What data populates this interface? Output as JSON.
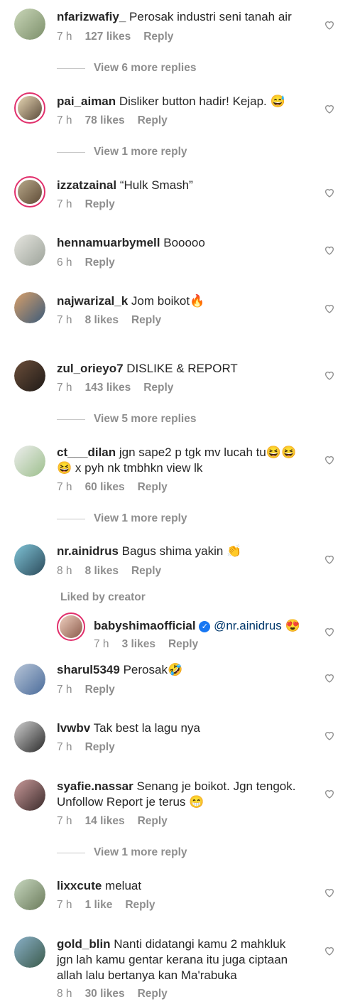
{
  "comments": [
    {
      "user": "nfarizwafiy_",
      "text": "Perosak industri seni tanah air",
      "time": "7 h",
      "likes": "127 likes",
      "reply": "Reply"
    },
    {
      "user": "pai_aiman",
      "text": "Disliker button hadir! Kejap. 😅",
      "time": "7 h",
      "likes": "78 likes",
      "reply": "Reply"
    },
    {
      "user": "izzatzainal",
      "text": "“Hulk Smash”",
      "time": "7 h",
      "likes": "",
      "reply": "Reply"
    },
    {
      "user": "hennamuarbymell",
      "text": "Booooo",
      "time": "6 h",
      "likes": "",
      "reply": "Reply"
    },
    {
      "user": "najwarizal_k",
      "text": "Jom boikot🔥",
      "time": "7 h",
      "likes": "8 likes",
      "reply": "Reply"
    },
    {
      "user": "zul_orieyo7",
      "text": "DISLIKE & REPORT",
      "time": "7 h",
      "likes": "143 likes",
      "reply": "Reply"
    },
    {
      "user": "ct___dilan",
      "text": "jgn sape2 p tgk mv lucah tu😆😆",
      "text2": "😆 x pyh nk tmbhkn view lk",
      "time": "7 h",
      "likes": "60 likes",
      "reply": "Reply"
    },
    {
      "user": "nr.ainidrus",
      "text": "Bagus shima yakin 👏",
      "time": "8 h",
      "likes": "8 likes",
      "reply": "Reply"
    },
    {
      "user": "babyshimaofficial",
      "mention": "@nr.ainidrus",
      "text": "😍",
      "time": "7 h",
      "likes": "3 likes",
      "reply": "Reply"
    },
    {
      "user": "sharul5349",
      "text": "Perosak🤣",
      "time": "7 h",
      "likes": "",
      "reply": "Reply"
    },
    {
      "user": "lvwbv",
      "text": "Tak best la lagu nya",
      "time": "7 h",
      "likes": "",
      "reply": "Reply"
    },
    {
      "user": "syafie.nassar",
      "text": "Senang je boikot. Jgn tengok.",
      "text2": "Unfollow Report je terus 😁",
      "time": "7 h",
      "likes": "14 likes",
      "reply": "Reply"
    },
    {
      "user": "lixxcute",
      "text": "meluat",
      "time": "7 h",
      "likes": "1 like",
      "reply": "Reply"
    },
    {
      "user": "gold_blin",
      "text": "Nanti didatangi kamu 2 mahkluk",
      "text2": "jgn lah kamu gentar kerana itu juga ciptaan",
      "text3": "allah lalu bertanya kan Ma'rabuka",
      "time": "8 h",
      "likes": "30 likes",
      "reply": "Reply"
    }
  ],
  "view_more": [
    "View 6 more replies",
    "View 1 more reply",
    "View 5 more replies",
    "View 1 more reply",
    "View 1 more reply"
  ],
  "liked_by_creator": "Liked by creator",
  "colors": {
    "ring": "#e1306c",
    "verified": "#1877f2",
    "meta": "#8e8e8e"
  }
}
